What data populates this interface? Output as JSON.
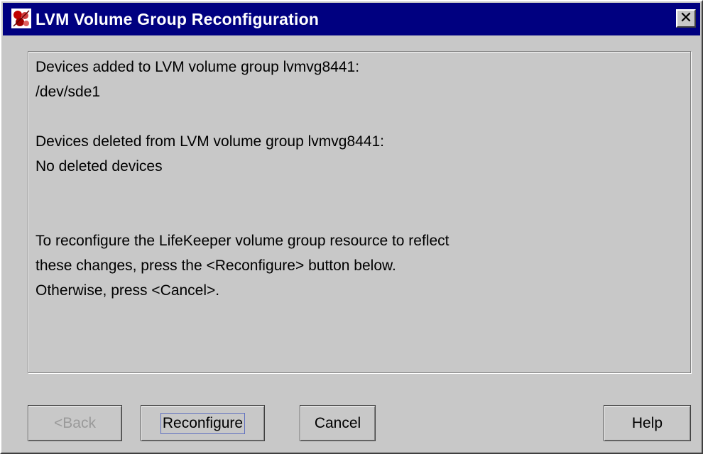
{
  "window": {
    "title": "LVM Volume Group Reconfiguration",
    "close_glyph": "✕"
  },
  "message": {
    "lines": [
      "Devices added to LVM volume group lvmvg8441:",
      "/dev/sde1",
      "Devices deleted from LVM volume group lvmvg8441:",
      "No deleted devices",
      "To reconfigure the LifeKeeper volume group resource to reflect",
      "these changes, press the <Reconfigure> button below.",
      "Otherwise, press <Cancel>."
    ]
  },
  "buttons": {
    "back": {
      "label": "<Back",
      "enabled": false
    },
    "reconfigure": {
      "label": "Reconfigure",
      "focused": true
    },
    "cancel": {
      "label": "Cancel"
    },
    "help": {
      "label": "Help"
    }
  },
  "colors": {
    "titlebar": "#000080",
    "window_bg": "#c8c8c8",
    "disabled_text": "#9a9a9a",
    "focus_ring": "#6070c0"
  }
}
